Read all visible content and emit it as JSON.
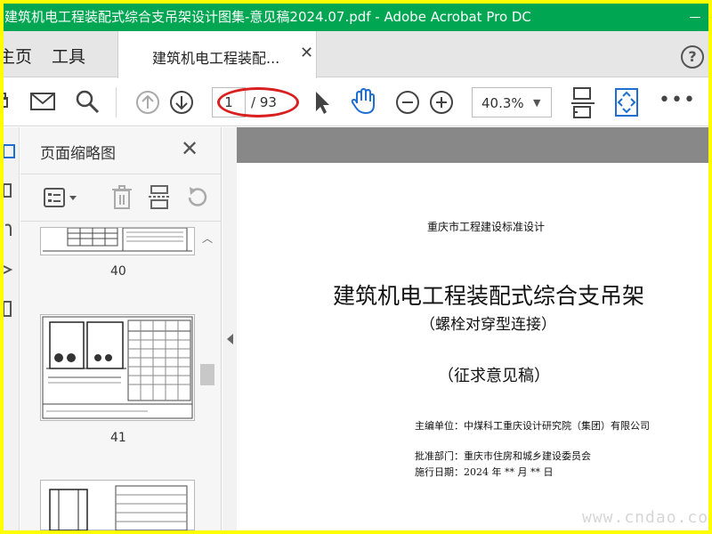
{
  "window": {
    "title": "建筑机电工程装配式综合支吊架设计图集-意见稿2024.07.pdf - Adobe Acrobat Pro DC"
  },
  "tabs": {
    "home_label": "主页",
    "tools_label": "工具",
    "doc_tab_label": "建筑机电工程装配...",
    "help_icon": "?"
  },
  "toolbar": {
    "current_page": "1",
    "total_pages": "/ 93",
    "zoom": "40.3%"
  },
  "thumbnails": {
    "panel_title": "页面缩略图",
    "pages": [
      {
        "label": "40"
      },
      {
        "label": "41"
      }
    ]
  },
  "document": {
    "org": "重庆市工程建设标准设计",
    "title": "建筑机电工程装配式综合支吊架",
    "subtitle": "（螺栓对穿型连接）",
    "draft": "（征求意见稿）",
    "editor": "主编单位：中煤科工重庆设计研究院（集团）有限公司",
    "approver": "批准部门：重庆市住房和城乡建设委员会",
    "effective": "施行日期：2024  年    **  月    **  日"
  },
  "watermark": "www.cndao.com",
  "colors": {
    "titlebar": "#00a651",
    "highlight_border": "#ffff00",
    "annotation_red": "#d92020"
  }
}
